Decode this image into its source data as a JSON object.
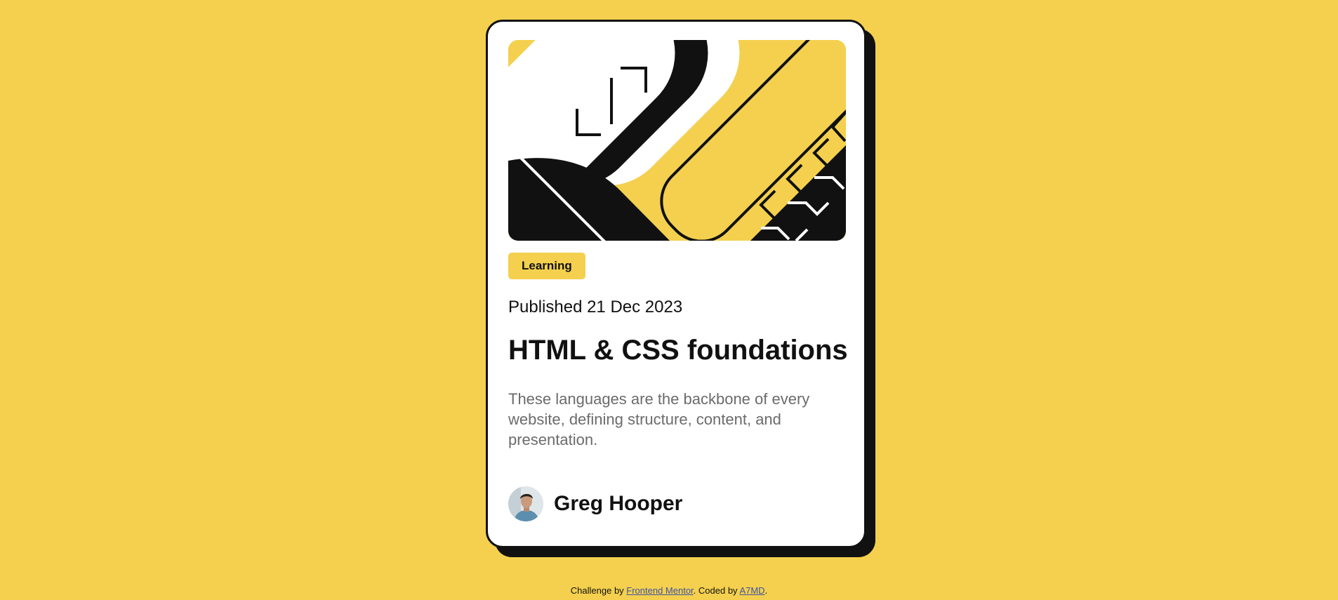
{
  "card": {
    "image_name": "illustration-article",
    "tag": "Learning",
    "published": "Published 21 Dec 2023",
    "title": "HTML & CSS foundations",
    "description": "These languages are the backbone of every website, defining structure, content, and presentation.",
    "author": {
      "name": "Greg Hooper",
      "avatar_icon": "avatar-greg-hooper"
    }
  },
  "attribution": {
    "prefix": "Challenge by ",
    "link1": "Frontend Mentor",
    "middle": ". Coded by ",
    "link2": "A7MD",
    "suffix": "."
  },
  "colors": {
    "background": "#f4d04e",
    "card": "#ffffff",
    "ink": "#111111",
    "muted": "#6b6b6b",
    "link": "#3e52a3"
  }
}
